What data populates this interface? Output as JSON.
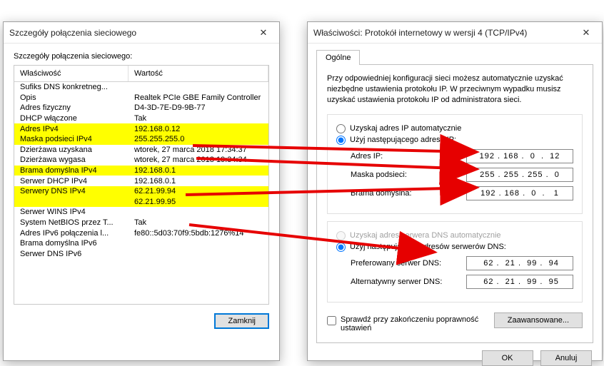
{
  "left": {
    "title": "Szczegóły połączenia sieciowego",
    "subhead": "Szczegóły połączenia sieciowego:",
    "col_prop": "Właściwość",
    "col_val": "Wartość",
    "rows": [
      {
        "p": "Sufiks DNS konkretneg...",
        "v": ""
      },
      {
        "p": "Opis",
        "v": "Realtek PCIe GBE Family Controller"
      },
      {
        "p": "Adres fizyczny",
        "v": "D4-3D-7E-D9-9B-77"
      },
      {
        "p": "DHCP włączone",
        "v": "Tak"
      },
      {
        "p": "Adres IPv4",
        "v": "192.168.0.12",
        "hl": true
      },
      {
        "p": "Maska podsieci IPv4",
        "v": "255.255.255.0",
        "hl": true
      },
      {
        "p": "Dzierżawa uzyskana",
        "v": "wtorek, 27 marca 2018 17:34:37"
      },
      {
        "p": "Dzierżawa wygasa",
        "v": "wtorek, 27 marca 2018 19:34:34"
      },
      {
        "p": "Brama domyślna IPv4",
        "v": "192.168.0.1",
        "hl": true
      },
      {
        "p": "Serwer DHCP IPv4",
        "v": "192.168.0.1"
      },
      {
        "p": "Serwery DNS IPv4",
        "v": "62.21.99.94",
        "hl": true
      },
      {
        "p": "",
        "v": "62.21.99.95",
        "hl": true
      },
      {
        "p": "Serwer WINS IPv4",
        "v": ""
      },
      {
        "p": "System NetBIOS przez T...",
        "v": "Tak"
      },
      {
        "p": "Adres IPv6 połączenia l...",
        "v": "fe80::5d03:70f9:5bdb:1276%14"
      },
      {
        "p": "Brama domyślna IPv6",
        "v": ""
      },
      {
        "p": "Serwer DNS IPv6",
        "v": ""
      }
    ],
    "close_btn": "Zamknij"
  },
  "right": {
    "title": "Właściwości: Protokół internetowy w wersji 4 (TCP/IPv4)",
    "tab_general": "Ogólne",
    "intro": "Przy odpowiedniej konfiguracji sieci możesz automatycznie uzyskać niezbędne ustawienia protokołu IP. W przeciwnym wypadku musisz uzyskać ustawienia protokołu IP od administratora sieci.",
    "r_ip_auto": "Uzyskaj adres IP automatycznie",
    "r_ip_manual": "Użyj następującego adresu IP:",
    "lbl_ip": "Adres IP:",
    "val_ip": "192 . 168 .  0  .  12",
    "lbl_mask": "Maska podsieci:",
    "val_mask": "255 . 255 . 255 .  0",
    "lbl_gw": "Brama domyślna:",
    "val_gw": "192 . 168 .  0  .   1",
    "r_dns_auto": "Uzyskaj adres serwera DNS automatycznie",
    "r_dns_manual": "Użyj następujących adresów serwerów DNS:",
    "lbl_dns1": "Preferowany serwer DNS:",
    "val_dns1": " 62 .  21 .  99 .  94",
    "lbl_dns2": "Alternatywny serwer DNS:",
    "val_dns2": " 62 .  21 .  99 .  95",
    "chk_validate": "Sprawdź przy zakończeniu poprawność ustawień",
    "btn_adv": "Zaawansowane...",
    "btn_ok": "OK",
    "btn_cancel": "Anuluj"
  }
}
